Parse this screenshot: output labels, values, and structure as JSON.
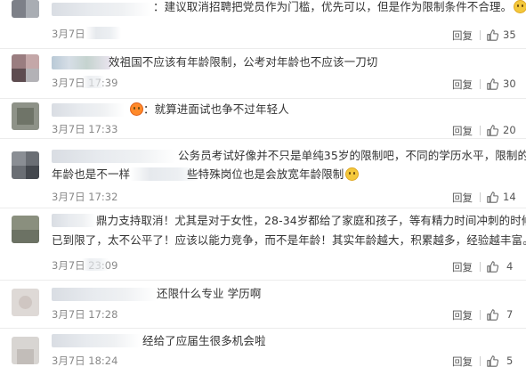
{
  "comments": [
    {
      "lines": [
        "：建议取消招聘把党员作为门槛，优先可以，但是作为限制条件不合理。"
      ],
      "date": "3月7日 17:40",
      "date_visible": "3月7日",
      "reply_label": "回复",
      "likes": "35",
      "emoji": "smile"
    },
    {
      "lines": [
        "效祖国不应该有年龄限制，公考对年龄也不应该一刀切"
      ],
      "date": "3月7日 17:39",
      "reply_label": "回复",
      "likes": "30"
    },
    {
      "lines": [
        "：就算进面试也争不过年轻人"
      ],
      "date": "3月7日 17:33",
      "reply_label": "回复",
      "likes": "20",
      "emoji_prefix": "tired"
    },
    {
      "lines": [
        "公务员考试好像并不只是单纯35岁的限制吧，不同的学历水平，限制的",
        "年龄也是不一样",
        "些特殊岗位也是会放宽年龄限制"
      ],
      "date": "3月7日 17:32",
      "reply_label": "回复",
      "likes": "14",
      "emoji": "smile"
    },
    {
      "lines": [
        "鼎力支持取消！尤其是对于女性，28-34岁都给了家庭和孩子，等有精力时间冲刺的时候",
        "已到限了，太不公平了！应该以能力竞争，而不是年龄！其实年龄越大，积累越多，经验越丰富。"
      ],
      "date": "3月7日 23:09",
      "reply_label": "回复",
      "likes": "4"
    },
    {
      "lines": [
        "还限什么专业 学历啊"
      ],
      "date": "3月7日 17:28",
      "reply_label": "回复",
      "likes": "7"
    },
    {
      "lines": [
        "经给了应届生很多机会啦"
      ],
      "date": "3月7日 18:24",
      "reply_label": "回复",
      "likes": "5"
    }
  ]
}
